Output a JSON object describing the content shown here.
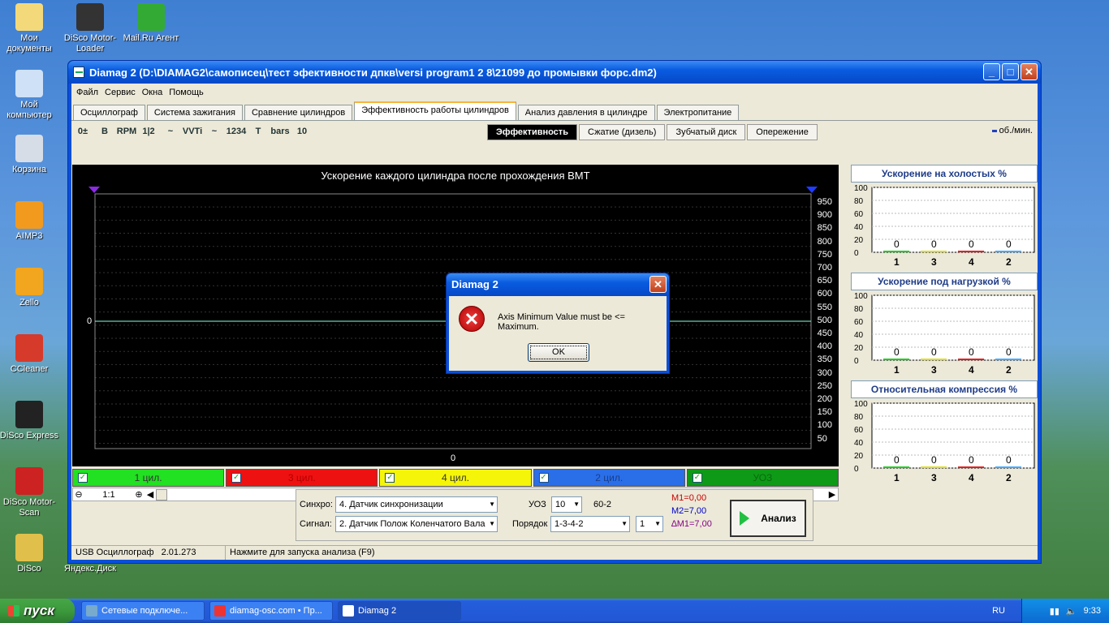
{
  "desktop": {
    "icons": [
      {
        "label": "Мои документы",
        "color": "#f4d97a"
      },
      {
        "label": "DiSco Motor-Loader",
        "color": "#333"
      },
      {
        "label": "Mail.Ru Агент",
        "color": "#3a3"
      },
      {
        "label": "Мой компьютер",
        "color": "#cfe1f7"
      },
      {
        "label": "Корзина",
        "color": "#d7dde6"
      },
      {
        "label": "AIMP3",
        "color": "#f29a1e"
      },
      {
        "label": "Zello",
        "color": "#f2a51e"
      },
      {
        "label": "CCleaner",
        "color": "#d63a2b"
      },
      {
        "label": "DiSco Express",
        "color": "#222"
      },
      {
        "label": "DiSco Motor-Scan",
        "color": "#cc2222"
      },
      {
        "label": "DiSco",
        "color": "#e0c04a"
      },
      {
        "label": "Яндекс.Диск",
        "color": "#6aa"
      }
    ]
  },
  "window": {
    "title": "Diamag 2 (D:\\DIAMAG2\\самописец\\тест эфективности дпкв\\versi program1 2 8\\21099 до промывки форс.dm2)",
    "menu": [
      "Файл",
      "Сервис",
      "Окна",
      "Помощь"
    ],
    "tabs": [
      {
        "label": "Осциллограф",
        "active": false
      },
      {
        "label": "Система зажигания",
        "active": false
      },
      {
        "label": "Сравнение цилиндров",
        "active": false
      },
      {
        "label": "Эффективность работы цилиндров",
        "active": true
      },
      {
        "label": "Анализ давления в цилиндре",
        "active": false
      },
      {
        "label": "Электропитание",
        "active": false
      }
    ],
    "toolbar": {
      "tools": [
        "0±",
        "B",
        "RPM",
        "1|2",
        "~",
        "VVTi",
        "~",
        "1234",
        "T",
        "bars",
        "10"
      ],
      "subtabs": [
        {
          "label": "Эффективность",
          "active": true
        },
        {
          "label": "Сжатие (дизель)",
          "active": false
        },
        {
          "label": "Зубчатый диск",
          "active": false
        },
        {
          "label": "Опережение",
          "active": false
        }
      ],
      "rpm_legend": "об./мин."
    },
    "chart": {
      "title": "Ускорение каждого цилиндра после прохождения ВМТ",
      "left_zero": "0",
      "bottom_zero": "0",
      "y_ticks": [
        "950",
        "900",
        "850",
        "800",
        "750",
        "700",
        "650",
        "600",
        "550",
        "500",
        "450",
        "400",
        "350",
        "300",
        "250",
        "200",
        "150",
        "100",
        "50"
      ]
    },
    "channels": [
      {
        "label": "1 цил.",
        "color": "#22e022",
        "text_color": "#333"
      },
      {
        "label": "3 цил.",
        "color": "#ee1111",
        "text_color": "#b40000"
      },
      {
        "label": "4 цил.",
        "color": "#f5f50a",
        "text_color": "#333"
      },
      {
        "label": "2 цил.",
        "color": "#2a6ee8",
        "text_color": "#1a3e8a"
      },
      {
        "label": "УОЗ",
        "color": "#0e9a16",
        "text_color": "#0a6a10"
      }
    ],
    "scrollbar": {
      "zoom": "1:1"
    },
    "side_panels": [
      {
        "title": "Ускорение на холостых %",
        "y_ticks": [
          "100",
          "80",
          "60",
          "40",
          "20",
          "0"
        ],
        "bars": [
          {
            "cyl": "1",
            "value": "0",
            "color": "#2c2"
          },
          {
            "cyl": "3",
            "value": "0",
            "color": "#dd2"
          },
          {
            "cyl": "4",
            "value": "0",
            "color": "#d22"
          },
          {
            "cyl": "2",
            "value": "0",
            "color": "#4af"
          }
        ]
      },
      {
        "title": "Ускорение под нагрузкой %",
        "y_ticks": [
          "100",
          "80",
          "60",
          "40",
          "20",
          "0"
        ],
        "bars": [
          {
            "cyl": "1",
            "value": "0",
            "color": "#2c2"
          },
          {
            "cyl": "3",
            "value": "0",
            "color": "#dd2"
          },
          {
            "cyl": "4",
            "value": "0",
            "color": "#d22"
          },
          {
            "cyl": "2",
            "value": "0",
            "color": "#4af"
          }
        ]
      },
      {
        "title": "Относительная компрессия %",
        "y_ticks": [
          "100",
          "80",
          "60",
          "40",
          "20",
          "0"
        ],
        "bars": [
          {
            "cyl": "1",
            "value": "0",
            "color": "#2c2"
          },
          {
            "cyl": "3",
            "value": "0",
            "color": "#dd2"
          },
          {
            "cyl": "4",
            "value": "0",
            "color": "#d22"
          },
          {
            "cyl": "2",
            "value": "0",
            "color": "#4af"
          }
        ]
      }
    ],
    "controls": {
      "sync_label": "Синхро:",
      "sync_value": "4.  Датчик синхронизации",
      "signal_label": "Сигнал:",
      "signal_value": "2.  Датчик Полож Коленчатого Вала",
      "uoz_label": "УОЗ",
      "uoz_value": "10",
      "teeth": "60-2",
      "order_label": "Порядок",
      "order_value": "1-3-4-2",
      "order_index": "1",
      "m1": "M1=0,00",
      "m2": "M2=7,00",
      "dm1": "∆M1=7,00",
      "analyze_label": "Анализ"
    },
    "status": {
      "device": "USB Осциллограф",
      "version": "2.01.273",
      "hint": "Нажмите для запуска анализа (F9)"
    }
  },
  "dialog": {
    "title": "Diamag 2",
    "message": "Axis Minimum Value must be <= Maximum.",
    "ok_label": "OK"
  },
  "taskbar": {
    "start_label": "пуск",
    "tasks": [
      {
        "label": "Сетевые подключе...",
        "icon_color": "#7ac"
      },
      {
        "label": "diamag-osc.com • Пр...",
        "icon_color": "#e33"
      },
      {
        "label": "Diamag 2",
        "icon_color": "#fff"
      }
    ],
    "lang": "RU",
    "clock": "9:33"
  }
}
